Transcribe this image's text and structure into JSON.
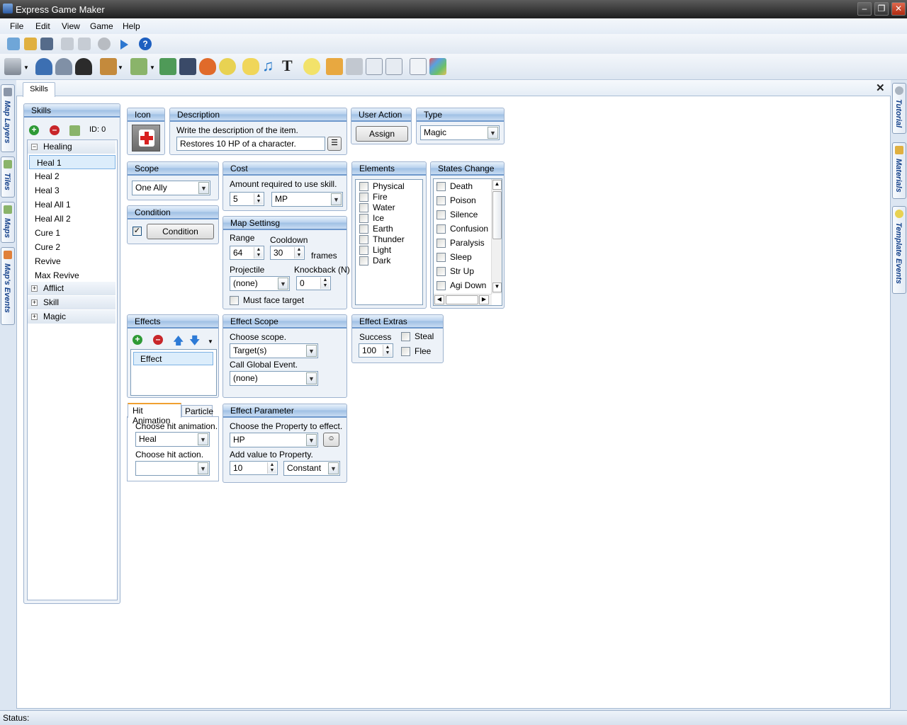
{
  "window": {
    "title": "Express Game Maker"
  },
  "menu": [
    "File",
    "Edit",
    "View",
    "Game",
    "Help"
  ],
  "document": {
    "tab": "Skills"
  },
  "left_dock": [
    "Map Layers",
    "Tiles",
    "Maps",
    "Map's Events"
  ],
  "right_dock": [
    "Tutorial",
    "Materials",
    "Template Events"
  ],
  "skills": {
    "title": "Skills",
    "id_label": "ID: 0",
    "groups": [
      {
        "name": "Healing",
        "items": [
          "Heal 1",
          "Heal 2",
          "Heal 3",
          "Heal All 1",
          "Heal All 2",
          "Cure 1",
          "Cure 2",
          "Revive",
          "Max Revive"
        ]
      },
      {
        "name": "Afflict"
      },
      {
        "name": "Skill"
      },
      {
        "name": "Magic"
      }
    ],
    "selected": "Heal 1"
  },
  "icon": {
    "title": "Icon"
  },
  "description": {
    "title": "Description",
    "hint": "Write the description of the item.",
    "value": "Restores 10 HP of a character."
  },
  "user_action": {
    "title": "User Action",
    "button": "Assign"
  },
  "type": {
    "title": "Type",
    "value": "Magic"
  },
  "scope": {
    "title": "Scope",
    "value": "One Ally"
  },
  "cost": {
    "title": "Cost",
    "hint": "Amount required to use skill.",
    "amount": "5",
    "unit": "MP"
  },
  "elements": {
    "title": "Elements",
    "items": [
      "Physical",
      "Fire",
      "Water",
      "Ice",
      "Earth",
      "Thunder",
      "Light",
      "Dark"
    ]
  },
  "states": {
    "title": "States Change",
    "items": [
      "Death",
      "Poison",
      "Silence",
      "Confusion",
      "Paralysis",
      "Sleep",
      "Str Up",
      "Agi Down"
    ]
  },
  "condition": {
    "title": "Condition",
    "button": "Condition",
    "checked": "✓"
  },
  "map_settings": {
    "title": "Map Settinsg",
    "range_label": "Range",
    "range": "64",
    "cooldown_label": "Cooldown",
    "cooldown": "30",
    "frames": "frames",
    "projectile_label": "Projectile",
    "projectile": "(none)",
    "knockback_label": "Knockback (N)",
    "knockback": "0",
    "must_face": "Must face target"
  },
  "effects": {
    "title": "Effects",
    "items": [
      "Effect"
    ]
  },
  "effect_scope": {
    "title": "Effect Scope",
    "choose": "Choose scope.",
    "scope": "Target(s)",
    "global_label": "Call Global Event.",
    "global": "(none)"
  },
  "effect_extras": {
    "title": "Effect Extras",
    "success_label": "Success",
    "success": "100",
    "steal": "Steal",
    "flee": "Flee"
  },
  "hit": {
    "tab1": "Hit Animation",
    "tab2": "Particle",
    "anim_label": "Choose hit animation.",
    "anim": "Heal",
    "action_label": "Choose hit action.",
    "action": ""
  },
  "effect_param": {
    "title": "Effect Parameter",
    "prop_label": "Choose the Property to effect.",
    "prop": "HP",
    "add_label": "Add value to Property.",
    "value": "10",
    "mode": "Constant"
  },
  "status": {
    "label": "Status:"
  }
}
